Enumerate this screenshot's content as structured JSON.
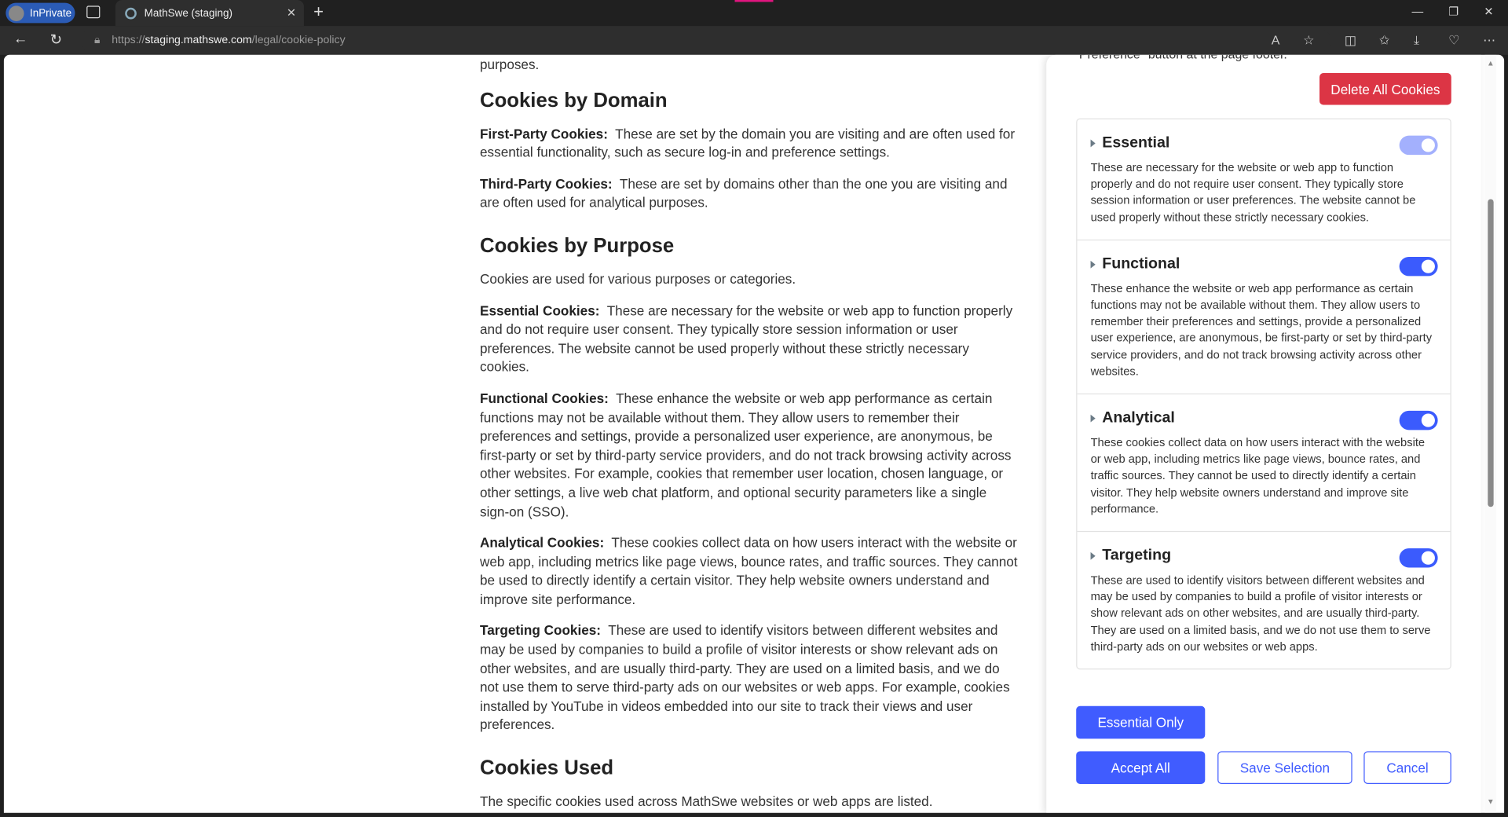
{
  "browser": {
    "inprivate": "InPrivate",
    "tab_title": "MathSwe (staging)",
    "url_scheme": "https://",
    "url_host": "staging.mathswe.com",
    "url_path": "/legal/cookie-policy"
  },
  "main": {
    "top_fragment": "purposes.",
    "sections": [
      {
        "heading": "Cookies by Domain",
        "paras": [
          {
            "bold": "First-Party Cookies:",
            "text": "These are set by the domain you are visiting and are often used for essential functionality, such as secure log-in and preference settings."
          },
          {
            "bold": "Third-Party Cookies:",
            "text": "These are set by domains other than the one you are visiting and are often used for analytical purposes."
          }
        ]
      },
      {
        "heading": "Cookies by Purpose",
        "paras": [
          {
            "bold": "",
            "text": "Cookies are used for various purposes or categories."
          },
          {
            "bold": "Essential Cookies:",
            "text": "These are necessary for the website or web app to function properly and do not require user consent. They typically store session information or user preferences. The website cannot be used properly without these strictly necessary cookies."
          },
          {
            "bold": "Functional Cookies:",
            "text": "These enhance the website or web app performance as certain functions may not be available without them. They allow users to remember their preferences and settings, provide a personalized user experience, are anonymous, be first-party or set by third-party service providers, and do not track browsing activity across other websites. For example, cookies that remember user location, chosen language, or other settings, a live web chat platform, and optional security parameters like a single sign-on (SSO)."
          },
          {
            "bold": "Analytical Cookies:",
            "text": "These cookies collect data on how users interact with the website or web app, including metrics like page views, bounce rates, and traffic sources. They cannot be used to directly identify a certain visitor. They help website owners understand and improve site performance."
          },
          {
            "bold": "Targeting Cookies:",
            "text": "These are used to identify visitors between different websites and may be used by companies to build a profile of visitor interests or show relevant ads on other websites, and are usually third-party. They are used on a limited basis, and we do not use them to serve third-party ads on our websites or web apps. For example, cookies installed by YouTube in videos embedded into our site to track their views and user preferences."
          }
        ]
      },
      {
        "heading": "Cookies Used",
        "paras": [
          {
            "bold": "",
            "text": "The specific cookies used across MathSwe websites or web apps are listed."
          }
        ]
      }
    ]
  },
  "panel": {
    "top_fragment": "Preference\" button at the page footer.",
    "delete_all": "Delete All Cookies",
    "categories": [
      {
        "name": "Essential",
        "enabled": true,
        "disabled": true,
        "desc": "These are necessary for the website or web app to function properly and do not require user consent. They typically store session information or user preferences. The website cannot be used properly without these strictly necessary cookies."
      },
      {
        "name": "Functional",
        "enabled": true,
        "disabled": false,
        "desc": "These enhance the website or web app performance as certain functions may not be available without them. They allow users to remember their preferences and settings, provide a personalized user experience, are anonymous, be first-party or set by third-party service providers, and do not track browsing activity across other websites."
      },
      {
        "name": "Analytical",
        "enabled": true,
        "disabled": false,
        "desc": "These cookies collect data on how users interact with the website or web app, including metrics like page views, bounce rates, and traffic sources. They cannot be used to directly identify a certain visitor. They help website owners understand and improve site performance."
      },
      {
        "name": "Targeting",
        "enabled": true,
        "disabled": false,
        "desc": "These are used to identify visitors between different websites and may be used by companies to build a profile of visitor interests or show relevant ads on other websites, and are usually third-party. They are used on a limited basis, and we do not use them to serve third-party ads on our websites or web apps."
      }
    ],
    "essential_only": "Essential Only",
    "accept_all": "Accept All",
    "save_selection": "Save Selection",
    "cancel": "Cancel"
  },
  "colors": {
    "primary": "#405cff",
    "danger": "#dc3545",
    "toggle_disabled": "#a3b0fd"
  }
}
